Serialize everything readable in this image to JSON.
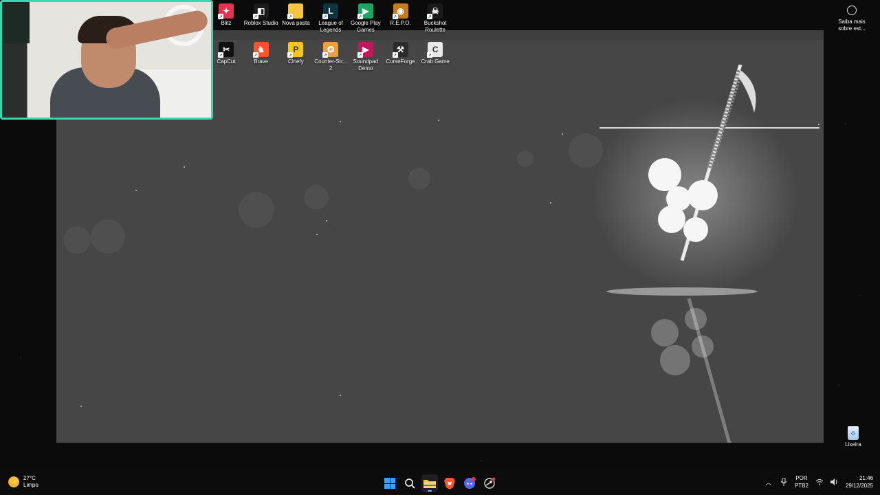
{
  "desktop": {
    "row1": [
      {
        "label": "Blitz",
        "icon": "blitz-icon",
        "color": "#e2334f",
        "glyph": "✦"
      },
      {
        "label": "Roblox Studio",
        "icon": "roblox-studio-icon",
        "color": "#1b1b1b",
        "glyph": "◧"
      },
      {
        "label": "Nova pasta",
        "icon": "folder-icon",
        "color": "#f5c542",
        "glyph": ""
      },
      {
        "label": "League of Legends",
        "icon": "league-of-legends-icon",
        "color": "#0e3440",
        "glyph": "L"
      },
      {
        "label": "Google Play Games",
        "icon": "google-play-games-icon",
        "color": "#1ea362",
        "glyph": "▶"
      },
      {
        "label": "R.E.P.O.",
        "icon": "repo-icon",
        "color": "#c77a1b",
        "glyph": "◉"
      },
      {
        "label": "Buckshot Roulette",
        "icon": "buckshot-roulette-icon",
        "color": "#1a1a1a",
        "glyph": "☠"
      }
    ],
    "row2": [
      {
        "label": "CapCut",
        "icon": "capcut-icon",
        "color": "#111111",
        "glyph": "✂"
      },
      {
        "label": "Brave",
        "icon": "brave-icon",
        "color": "#fb542b",
        "glyph": "♞"
      },
      {
        "label": "Cinefy",
        "icon": "cinefy-icon",
        "color": "#f3c623",
        "glyph": "P"
      },
      {
        "label": "Counter-Str... 2",
        "icon": "counter-strike-icon",
        "color": "#e9a23b",
        "glyph": "✪"
      },
      {
        "label": "Soundpad Demo",
        "icon": "soundpad-icon",
        "color": "#c2185b",
        "glyph": "▶"
      },
      {
        "label": "CurseForge",
        "icon": "curseforge-icon",
        "color": "#2b2b2b",
        "glyph": "⚒"
      },
      {
        "label": "Crab Game",
        "icon": "crab-game-icon",
        "color": "#e8e8e8",
        "glyph": "C"
      }
    ],
    "side_widget": {
      "label": "Saiba mais sobre est..."
    },
    "recycle_bin": {
      "label": "Lixeira"
    }
  },
  "taskbar": {
    "weather": {
      "temp": "27°C",
      "condition": "Limpo"
    },
    "apps": [
      {
        "name": "start-button",
        "icon": "windows-icon"
      },
      {
        "name": "search-button",
        "icon": "search-icon"
      },
      {
        "name": "file-explorer-button",
        "icon": "folder-icon"
      },
      {
        "name": "brave-taskbar-button",
        "icon": "brave-icon"
      },
      {
        "name": "discord-taskbar-button",
        "icon": "discord-icon"
      },
      {
        "name": "steam-taskbar-button",
        "icon": "steam-icon"
      }
    ],
    "language": {
      "line1": "POR",
      "line2": "PTB2"
    },
    "clock": {
      "time": "21:46",
      "date": "29/12/2025"
    }
  }
}
